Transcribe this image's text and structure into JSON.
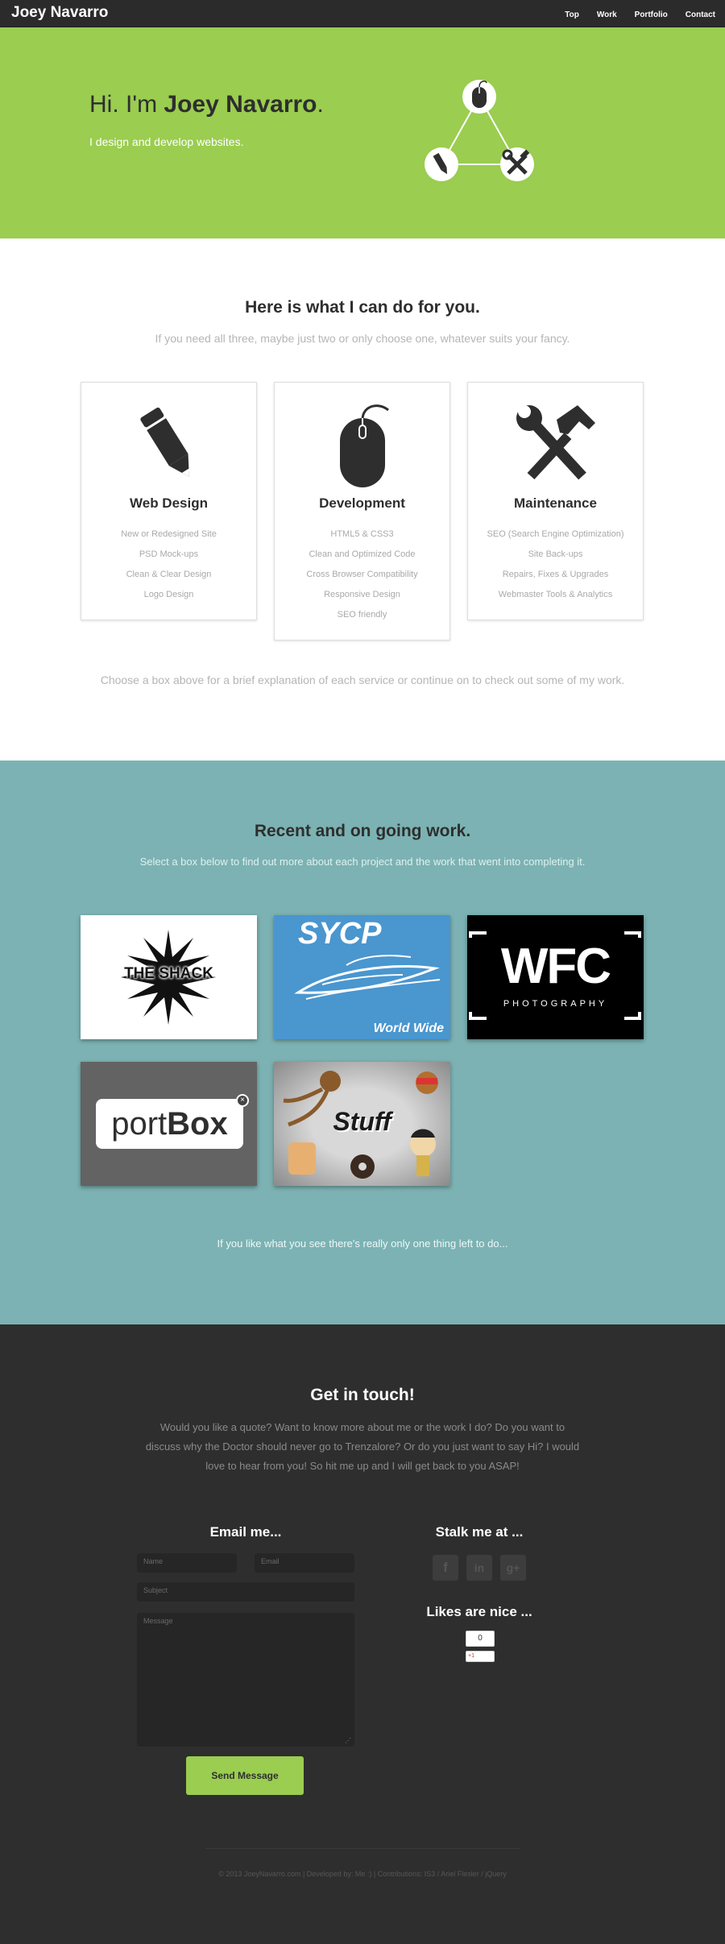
{
  "nav": {
    "brand": "Joey Navarro",
    "links": [
      "Top",
      "Work",
      "Portfolio",
      "Contact"
    ]
  },
  "hero": {
    "greeting": "Hi. I'm ",
    "name": "Joey Navarro",
    "period": ".",
    "subtitle": "I design and develop websites.",
    "diagram_icons": [
      "mouse-icon",
      "pencil-icon",
      "tools-icon"
    ]
  },
  "services": {
    "title": "Here is what I can do for you.",
    "subtitle": "If you need all three, maybe just two or only choose one, whatever suits your fancy.",
    "cards": [
      {
        "icon": "pencil-icon",
        "title": "Web Design",
        "items": [
          "New or Redesigned Site",
          "PSD Mock-ups",
          "Clean & Clear Design",
          "Logo Design"
        ]
      },
      {
        "icon": "mouse-icon",
        "title": "Development",
        "items": [
          "HTML5 & CSS3",
          "Clean and Optimized Code",
          "Cross Browser Compatibility",
          "Responsive Design",
          "SEO friendly"
        ]
      },
      {
        "icon": "tools-icon",
        "title": "Maintenance",
        "items": [
          "SEO (Search Engine Optimization)",
          "Site Back-ups",
          "Repairs, Fixes & Upgrades",
          "Webmaster Tools & Analytics"
        ]
      }
    ],
    "footnote": "Choose a box above for a brief explanation of each service or continue on to check out some of my work."
  },
  "work": {
    "title": "Recent and on going work.",
    "subtitle": "Select a box below to find out more about each project and the work that went into completing it.",
    "projects": [
      {
        "label": "THE SHACK"
      },
      {
        "label": "SYCP",
        "caption": "World Wide"
      },
      {
        "label": "WFC",
        "caption": "PHOTOGRAPHY"
      },
      {
        "label_light": "port",
        "label_bold": "Box"
      },
      {
        "label": "Stuff"
      }
    ],
    "footnote": "If you like what you see there's really only one thing left to do..."
  },
  "contact": {
    "title": "Get in touch!",
    "text": "Would you like a quote? Want to know more about me or the work I do? Do you want to discuss why the Doctor should never go to Trenzalore? Or do you just want to say Hi? I would love to hear from you! So hit me up and I will get back to you ASAP!",
    "email_title": "Email me...",
    "name_placeholder": "Name",
    "email_placeholder": "Email",
    "subject_placeholder": "Subject",
    "message_placeholder": "Message",
    "send_label": "Send Message",
    "stalk_title": "Stalk me at ...",
    "social": [
      {
        "icon": "facebook-icon",
        "glyph": "f"
      },
      {
        "icon": "linkedin-icon",
        "glyph": "in"
      },
      {
        "icon": "google-plus-icon",
        "glyph": "g+"
      }
    ],
    "likes_title": "Likes are nice ...",
    "like_count": "0",
    "like_button": "+1",
    "copyright": "© 2013 JoeyNavarro.com | Developed by: Me :) | Contributions: IS3 / Ariel Flesler / jQuery"
  },
  "colors": {
    "accent_green": "#9acd50",
    "teal": "#7cb2b3",
    "dark": "#2e2e2e"
  }
}
